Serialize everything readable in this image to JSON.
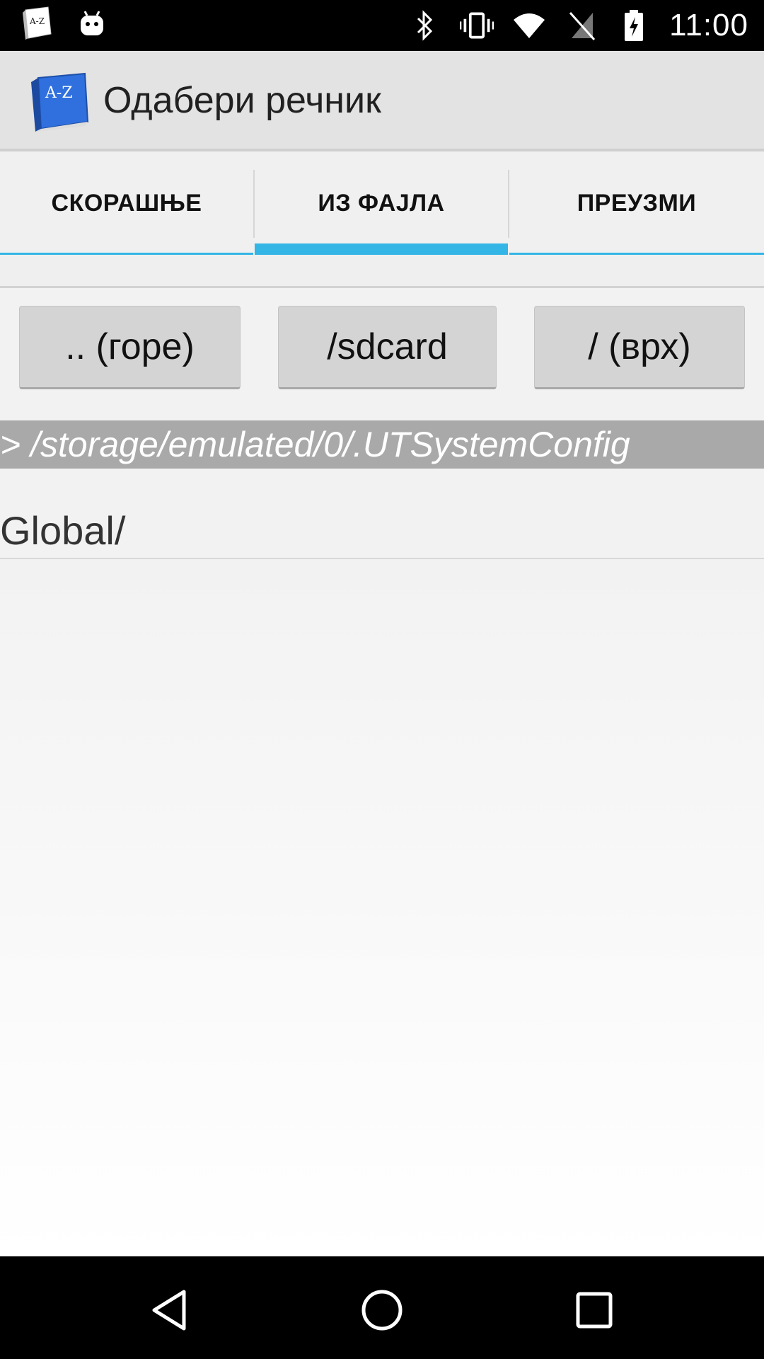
{
  "status_bar": {
    "time": "11:00",
    "left_icons": [
      "dictionary-notification-icon",
      "android-notification-icon"
    ],
    "right_icons": [
      "bluetooth-icon",
      "vibrate-icon",
      "wifi-icon",
      "no-sim-icon",
      "battery-charging-icon"
    ]
  },
  "action_bar": {
    "title": "Одабери речник",
    "logo_text": "A-Z"
  },
  "tabs": [
    {
      "label": "СКОРАШЊЕ",
      "selected": false
    },
    {
      "label": "ИЗ ФАЈЛА",
      "selected": true
    },
    {
      "label": "ПРЕУЗМИ",
      "selected": false
    }
  ],
  "buttons": {
    "up": ".. (горе)",
    "sdcard": "/sdcard",
    "top": "/ (врх)"
  },
  "path": "> /storage/emulated/0/.UTSystemConfig",
  "files": [
    "Global/"
  ],
  "nav": [
    "back-icon",
    "home-icon",
    "recents-icon"
  ],
  "colors": {
    "accent": "#33b5e5",
    "path_bg": "#a9a9a9"
  }
}
